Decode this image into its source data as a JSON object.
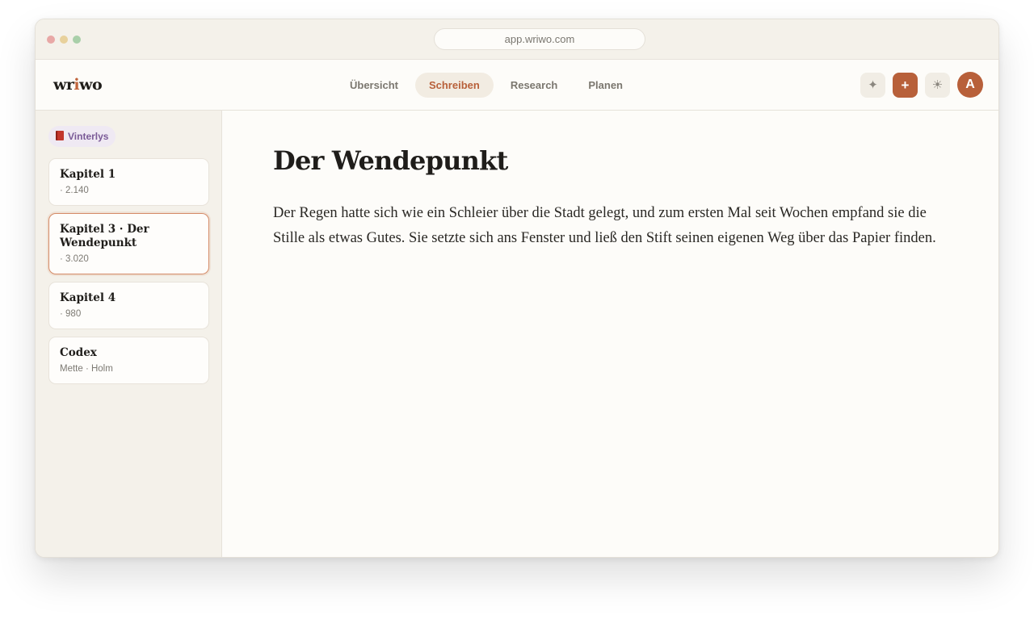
{
  "browser": {
    "url": "app.wriwo.com"
  },
  "header": {
    "logo_pre": "wr",
    "logo_accent": "i",
    "logo_post": "wo",
    "tabs": [
      {
        "label": "Übersicht"
      },
      {
        "label": "Schreiben"
      },
      {
        "label": "Research"
      },
      {
        "label": "Planen"
      }
    ],
    "spark_glyph": "✦",
    "plus_glyph": "+",
    "sun_glyph": "☀",
    "avatar_initial": "A"
  },
  "sidebar": {
    "project": "Vinterlys",
    "items": [
      {
        "title": "Kapitel 1",
        "sub": "· 2.140"
      },
      {
        "title": "Kapitel 3 · Der Wendepunkt",
        "sub": "· 3.020"
      },
      {
        "title": "Kapitel 4",
        "sub": "· 980"
      },
      {
        "title": "Codex",
        "sub": "Mette · Holm"
      }
    ]
  },
  "editor": {
    "title": "Der Wendepunkt",
    "body": "Der Regen hatte sich wie ein Schleier über die Stadt gelegt, und zum ersten Mal seit Wochen empfand sie die Stille als etwas Gutes. Sie setzte sich ans Fenster und ließ den Stift seinen eigenen Weg über das Papier finden."
  },
  "colors": {
    "accent": "#b8603a",
    "active_border": "#d48a66",
    "sidebar_bg": "#f4f1ea",
    "project_badge_text": "#7a5a97"
  },
  "icons": [
    "sparkle-icon",
    "plus-icon",
    "sun-icon",
    "book-icon"
  ]
}
